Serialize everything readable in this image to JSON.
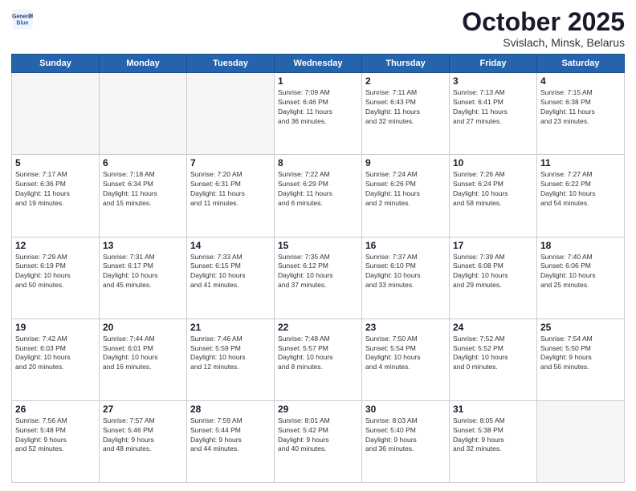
{
  "header": {
    "logo_line1": "General",
    "logo_line2": "Blue",
    "title": "October 2025",
    "subtitle": "Svislach, Minsk, Belarus"
  },
  "weekdays": [
    "Sunday",
    "Monday",
    "Tuesday",
    "Wednesday",
    "Thursday",
    "Friday",
    "Saturday"
  ],
  "weeks": [
    [
      {
        "day": "",
        "info": ""
      },
      {
        "day": "",
        "info": ""
      },
      {
        "day": "",
        "info": ""
      },
      {
        "day": "1",
        "info": "Sunrise: 7:09 AM\nSunset: 6:46 PM\nDaylight: 11 hours\nand 36 minutes."
      },
      {
        "day": "2",
        "info": "Sunrise: 7:11 AM\nSunset: 6:43 PM\nDaylight: 11 hours\nand 32 minutes."
      },
      {
        "day": "3",
        "info": "Sunrise: 7:13 AM\nSunset: 6:41 PM\nDaylight: 11 hours\nand 27 minutes."
      },
      {
        "day": "4",
        "info": "Sunrise: 7:15 AM\nSunset: 6:38 PM\nDaylight: 11 hours\nand 23 minutes."
      }
    ],
    [
      {
        "day": "5",
        "info": "Sunrise: 7:17 AM\nSunset: 6:36 PM\nDaylight: 11 hours\nand 19 minutes."
      },
      {
        "day": "6",
        "info": "Sunrise: 7:18 AM\nSunset: 6:34 PM\nDaylight: 11 hours\nand 15 minutes."
      },
      {
        "day": "7",
        "info": "Sunrise: 7:20 AM\nSunset: 6:31 PM\nDaylight: 11 hours\nand 11 minutes."
      },
      {
        "day": "8",
        "info": "Sunrise: 7:22 AM\nSunset: 6:29 PM\nDaylight: 11 hours\nand 6 minutes."
      },
      {
        "day": "9",
        "info": "Sunrise: 7:24 AM\nSunset: 6:26 PM\nDaylight: 11 hours\nand 2 minutes."
      },
      {
        "day": "10",
        "info": "Sunrise: 7:26 AM\nSunset: 6:24 PM\nDaylight: 10 hours\nand 58 minutes."
      },
      {
        "day": "11",
        "info": "Sunrise: 7:27 AM\nSunset: 6:22 PM\nDaylight: 10 hours\nand 54 minutes."
      }
    ],
    [
      {
        "day": "12",
        "info": "Sunrise: 7:29 AM\nSunset: 6:19 PM\nDaylight: 10 hours\nand 50 minutes."
      },
      {
        "day": "13",
        "info": "Sunrise: 7:31 AM\nSunset: 6:17 PM\nDaylight: 10 hours\nand 45 minutes."
      },
      {
        "day": "14",
        "info": "Sunrise: 7:33 AM\nSunset: 6:15 PM\nDaylight: 10 hours\nand 41 minutes."
      },
      {
        "day": "15",
        "info": "Sunrise: 7:35 AM\nSunset: 6:12 PM\nDaylight: 10 hours\nand 37 minutes."
      },
      {
        "day": "16",
        "info": "Sunrise: 7:37 AM\nSunset: 6:10 PM\nDaylight: 10 hours\nand 33 minutes."
      },
      {
        "day": "17",
        "info": "Sunrise: 7:39 AM\nSunset: 6:08 PM\nDaylight: 10 hours\nand 29 minutes."
      },
      {
        "day": "18",
        "info": "Sunrise: 7:40 AM\nSunset: 6:06 PM\nDaylight: 10 hours\nand 25 minutes."
      }
    ],
    [
      {
        "day": "19",
        "info": "Sunrise: 7:42 AM\nSunset: 6:03 PM\nDaylight: 10 hours\nand 20 minutes."
      },
      {
        "day": "20",
        "info": "Sunrise: 7:44 AM\nSunset: 6:01 PM\nDaylight: 10 hours\nand 16 minutes."
      },
      {
        "day": "21",
        "info": "Sunrise: 7:46 AM\nSunset: 5:59 PM\nDaylight: 10 hours\nand 12 minutes."
      },
      {
        "day": "22",
        "info": "Sunrise: 7:48 AM\nSunset: 5:57 PM\nDaylight: 10 hours\nand 8 minutes."
      },
      {
        "day": "23",
        "info": "Sunrise: 7:50 AM\nSunset: 5:54 PM\nDaylight: 10 hours\nand 4 minutes."
      },
      {
        "day": "24",
        "info": "Sunrise: 7:52 AM\nSunset: 5:52 PM\nDaylight: 10 hours\nand 0 minutes."
      },
      {
        "day": "25",
        "info": "Sunrise: 7:54 AM\nSunset: 5:50 PM\nDaylight: 9 hours\nand 56 minutes."
      }
    ],
    [
      {
        "day": "26",
        "info": "Sunrise: 7:56 AM\nSunset: 5:48 PM\nDaylight: 9 hours\nand 52 minutes."
      },
      {
        "day": "27",
        "info": "Sunrise: 7:57 AM\nSunset: 5:46 PM\nDaylight: 9 hours\nand 48 minutes."
      },
      {
        "day": "28",
        "info": "Sunrise: 7:59 AM\nSunset: 5:44 PM\nDaylight: 9 hours\nand 44 minutes."
      },
      {
        "day": "29",
        "info": "Sunrise: 8:01 AM\nSunset: 5:42 PM\nDaylight: 9 hours\nand 40 minutes."
      },
      {
        "day": "30",
        "info": "Sunrise: 8:03 AM\nSunset: 5:40 PM\nDaylight: 9 hours\nand 36 minutes."
      },
      {
        "day": "31",
        "info": "Sunrise: 8:05 AM\nSunset: 5:38 PM\nDaylight: 9 hours\nand 32 minutes."
      },
      {
        "day": "",
        "info": ""
      }
    ]
  ]
}
